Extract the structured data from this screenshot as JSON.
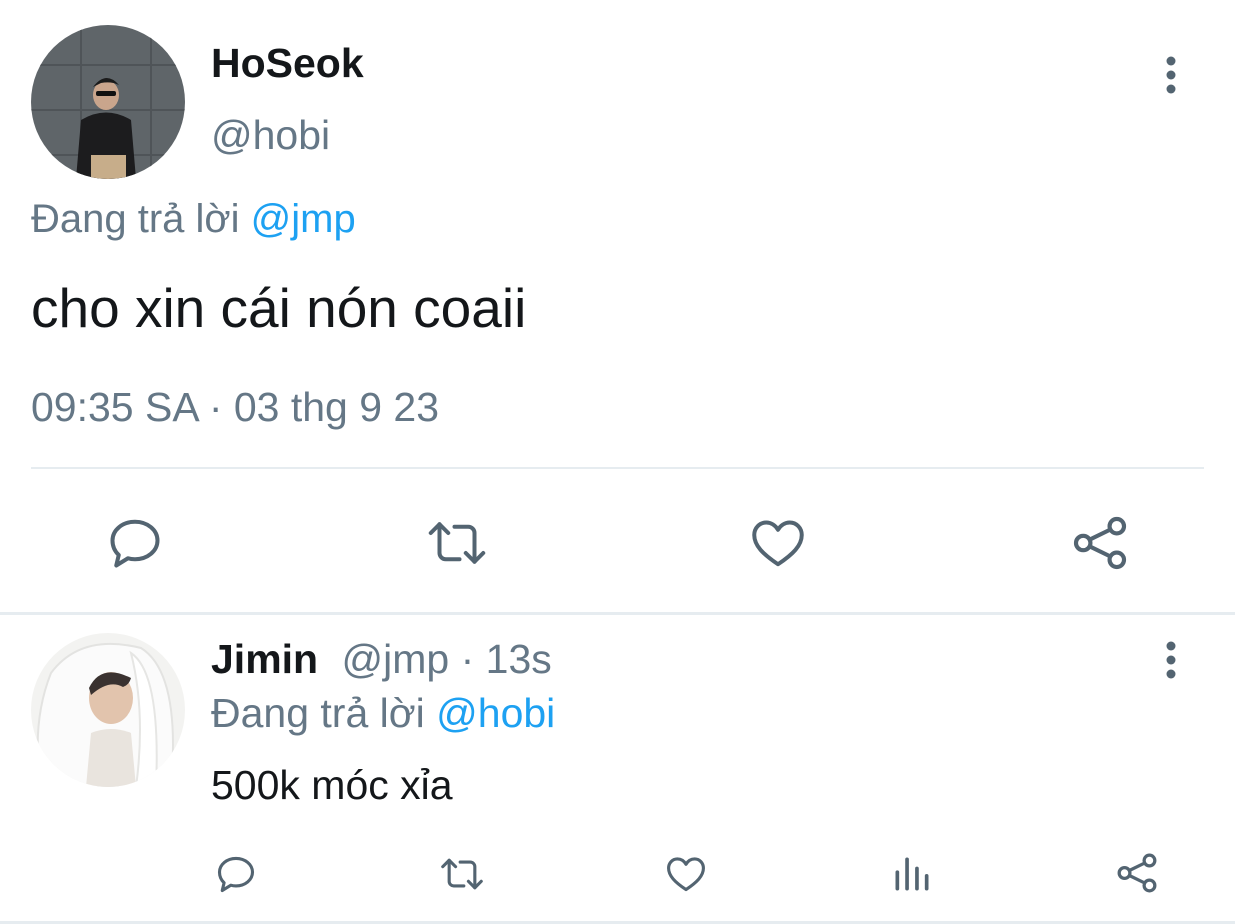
{
  "main_tweet": {
    "display_name": "HoSeok",
    "handle": "@hobi",
    "reply_prefix": "Đang trả lời",
    "reply_to": "@jmp",
    "text": "cho xin cái nón coaii",
    "timestamp": "09:35 SA · 03 thg 9 23",
    "actions": [
      "reply-icon",
      "retweet-icon",
      "like-icon",
      "share-icon"
    ]
  },
  "reply_tweet": {
    "display_name": "Jimin",
    "handle": "@jmp",
    "separator": "·",
    "time_ago": "13s",
    "reply_prefix": "Đang trả lời",
    "reply_to": "@hobi",
    "text": "500k móc xỉa",
    "actions": [
      "reply-icon",
      "retweet-icon",
      "like-icon",
      "analytics-icon",
      "share-icon"
    ]
  },
  "colors": {
    "accent": "#1da1f2",
    "muted": "#657786",
    "icon": "#536471",
    "divider": "#e6ecf0"
  }
}
